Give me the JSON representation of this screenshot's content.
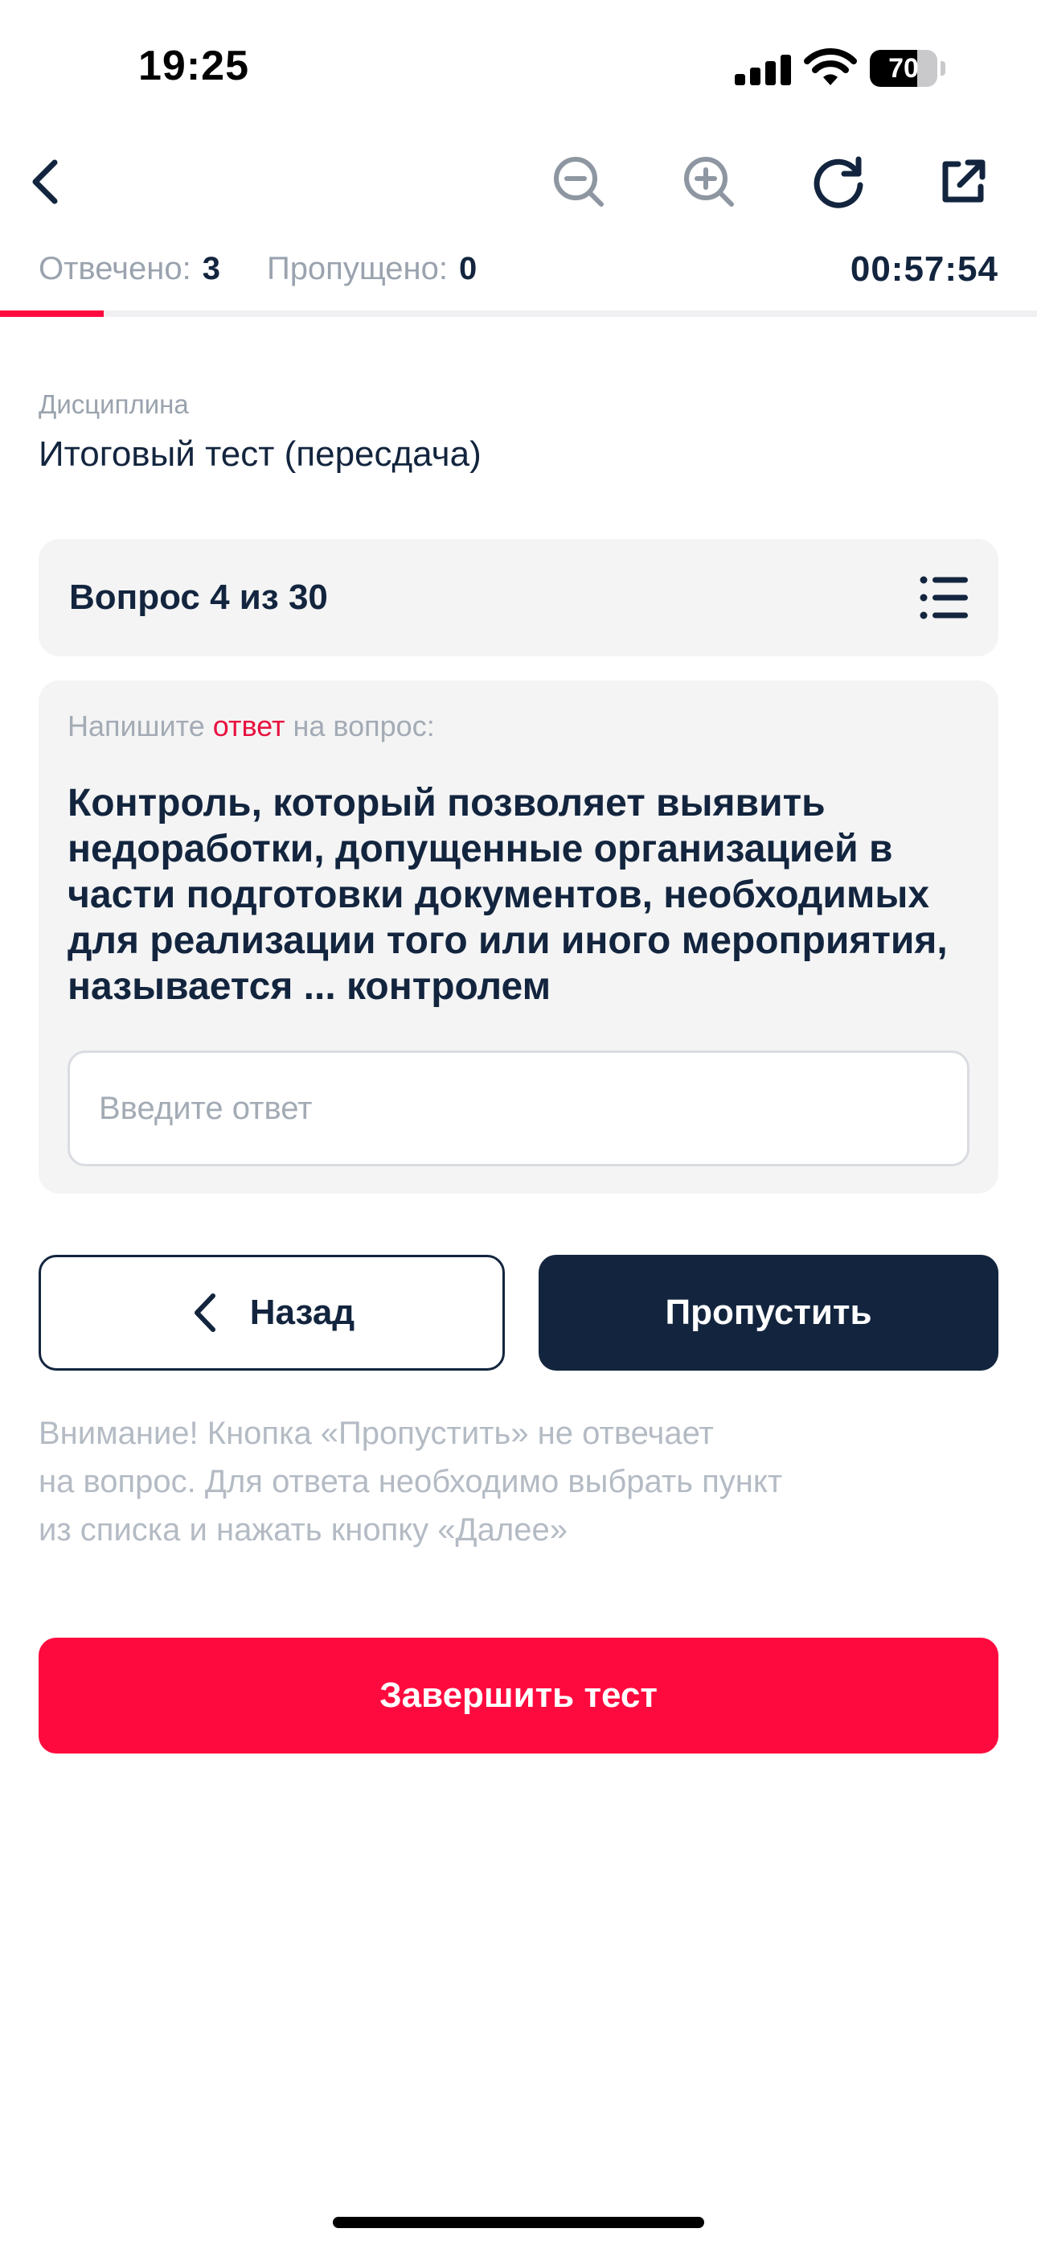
{
  "status_bar": {
    "time": "19:25",
    "battery": "70",
    "battery_level": 0.7
  },
  "toolbar": {
    "icons": [
      "back-chevron-icon",
      "zoom-out-icon",
      "zoom-in-icon",
      "refresh-icon",
      "external-link-icon"
    ]
  },
  "progress": {
    "answered_label": "Отвечено:",
    "answered_value": "3",
    "skipped_label": "Пропущено:",
    "skipped_value": "0",
    "timer": "00:57:54",
    "fraction": 0.1
  },
  "discipline": {
    "label": "Дисциплина",
    "value": "Итоговый тест (пересдача)"
  },
  "question_bar": {
    "label": "Вопрос 4 из 30",
    "icon": "list-icon"
  },
  "question": {
    "prompt_prefix": "Напишите",
    "prompt_accent": "ответ",
    "prompt_suffix": "на вопрос:",
    "text": "Контроль, который позволяет выявить недоработки, допущенные организацией в части подготовки документов, необходимых для реализации того или иного мероприятия, называется ... контролем",
    "input_value": "",
    "input_placeholder": "Введите ответ"
  },
  "buttons": {
    "back": "Назад",
    "skip": "Пропустить",
    "finish": "Завершить тест"
  },
  "warning_lines": [
    "Внимание! Кнопка «Пропустить» не отвечает",
    "на вопрос. Для ответа необходимо выбрать пункт",
    "из списка и нажать кнопку «Далее»"
  ],
  "colors": {
    "navy": "#13253e",
    "accent": "#ff0a3f",
    "muted": "#9aa3ae",
    "card": "#f4f4f5"
  }
}
